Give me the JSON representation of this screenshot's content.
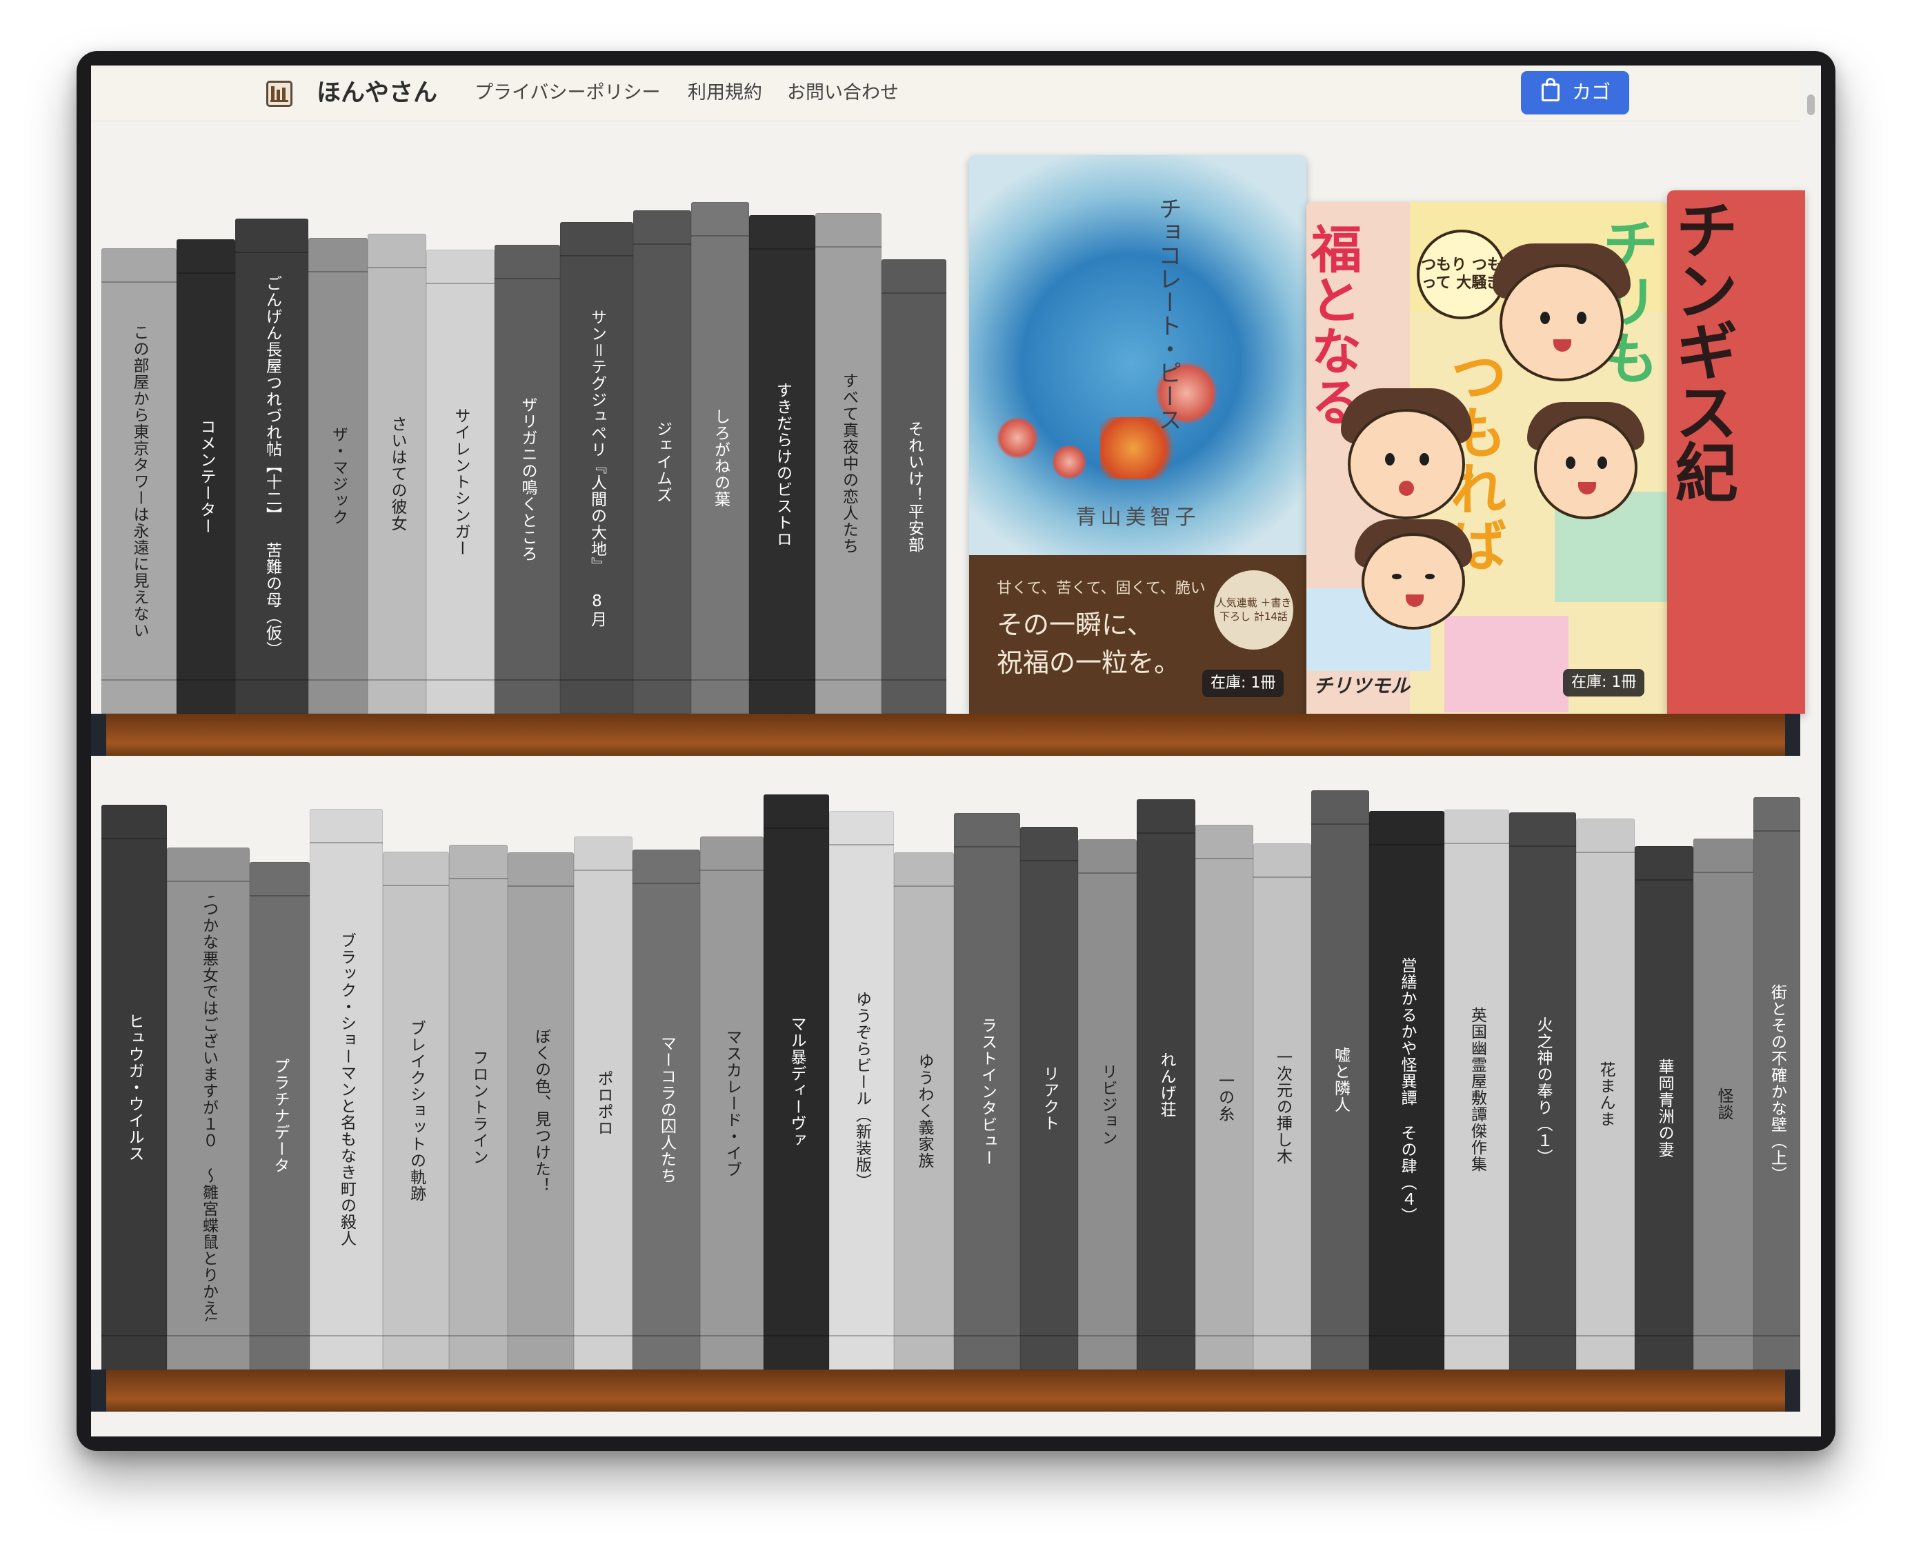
{
  "navbar": {
    "brand": "ほんやさん",
    "links": [
      "プライバシーポリシー",
      "利用規約",
      "お問い合わせ"
    ],
    "cart_label": "カゴ",
    "accent_color": "#3b6fe0"
  },
  "shelf1": {
    "spines": [
      {
        "title": "この部屋から東京タワーは永遠に見えない",
        "color": "#a7a7a7",
        "text_color": "#222222"
      },
      {
        "title": "コメンテーター",
        "color": "#2c2c2c",
        "text_color": "#ffffff"
      },
      {
        "title": "ごんげん長屋つれづれ帖【十二】 苦難の母（仮）",
        "color": "#3c3c3c",
        "text_color": "#ffffff"
      },
      {
        "title": "ザ・マジック",
        "color": "#909090",
        "text_color": "#1e1e1e"
      },
      {
        "title": "さいはての彼女",
        "color": "#bcbcbc",
        "text_color": "#222222"
      },
      {
        "title": "サイレントシンガー",
        "color": "#d2d2d2",
        "text_color": "#222222"
      },
      {
        "title": "ザリガニの鳴くところ",
        "color": "#5e5e5e",
        "text_color": "#ffffff"
      },
      {
        "title": "サン＝テグジュペリ『人間の大地』 8月",
        "color": "#4b4b4b",
        "text_color": "#ffffff"
      },
      {
        "title": "ジェイムズ",
        "color": "#565656",
        "text_color": "#ffffff"
      },
      {
        "title": "しろがねの葉",
        "color": "#777777",
        "text_color": "#ffffff"
      },
      {
        "title": "すきだらけのビストロ",
        "color": "#2e2e2e",
        "text_color": "#ffffff"
      },
      {
        "title": "すべて真夜中の恋人たち",
        "color": "#a0a0a0",
        "text_color": "#1e1e1e"
      },
      {
        "title": "それいけ！平安部",
        "color": "#5a5a5a",
        "text_color": "#ffffff"
      }
    ],
    "covers": [
      {
        "title": "チョコレート・ピース",
        "author": "青山美智子",
        "tagline": "甘くて、苦くて、固くて、脆い",
        "copy_lines": [
          "その一瞬に、",
          "祝福の一粒を。"
        ],
        "badge": "人気連載 ＋書き下ろし 計14話",
        "stock": "在庫: 1冊"
      },
      {
        "title": "チリもつもれば福となる",
        "bubble": "つもり つもって 大騒ぎ",
        "footer": "チリツモル",
        "stock": "在庫: 1冊"
      },
      {
        "title": "チンギス紀"
      }
    ]
  },
  "shelf2": {
    "spines": [
      {
        "title": "ヒュウガ・ウイルス",
        "color": "#3a3a3a",
        "text_color": "#ffffff"
      },
      {
        "title": "ふつつかな悪女ではございますが１０ 〜雛宮蝶鼠とりかえ伝〜",
        "color": "#939393",
        "text_color": "#1e1e1e"
      },
      {
        "title": "プラチナデータ",
        "color": "#6e6e6e",
        "text_color": "#ffffff"
      },
      {
        "title": "ブラック・ショーマンと名もなき町の殺人",
        "color": "#d6d6d6",
        "text_color": "#222222"
      },
      {
        "title": "ブレイクショットの軌跡",
        "color": "#c5c5c5",
        "text_color": "#222222"
      },
      {
        "title": "フロントライン",
        "color": "#b6b6b6",
        "text_color": "#222222"
      },
      {
        "title": "ぼくの色、見つけた！",
        "color": "#a4a4a4",
        "text_color": "#1e1e1e"
      },
      {
        "title": "ポロポロ",
        "color": "#d0d0d0",
        "text_color": "#222222"
      },
      {
        "title": "マーコラの囚人たち",
        "color": "#717171",
        "text_color": "#ffffff"
      },
      {
        "title": "マスカレード・イブ",
        "color": "#9a9a9a",
        "text_color": "#1e1e1e"
      },
      {
        "title": "マル暴ディーヴァ",
        "color": "#2a2a2a",
        "text_color": "#ffffff"
      },
      {
        "title": "ゆうぞらビール（新装版）",
        "color": "#dcdcdc",
        "text_color": "#222222"
      },
      {
        "title": "ゆうわく義家族",
        "color": "#bababa",
        "text_color": "#222222"
      },
      {
        "title": "ラストインタビュー",
        "color": "#666666",
        "text_color": "#ffffff"
      },
      {
        "title": "リアクト",
        "color": "#494949",
        "text_color": "#ffffff"
      },
      {
        "title": "リビジョン",
        "color": "#8e8e8e",
        "text_color": "#1e1e1e"
      },
      {
        "title": "れんげ荘",
        "color": "#404040",
        "text_color": "#ffffff"
      },
      {
        "title": "一の糸",
        "color": "#b0b0b0",
        "text_color": "#222222"
      },
      {
        "title": "一次元の挿し木",
        "color": "#c2c2c2",
        "text_color": "#222222"
      },
      {
        "title": "嘘と隣人",
        "color": "#5c5c5c",
        "text_color": "#ffffff"
      },
      {
        "title": "営繕かるかや怪異譚 その肆（４）",
        "color": "#282828",
        "text_color": "#ffffff"
      },
      {
        "title": "英国幽霊屋敷譚傑作集",
        "color": "#cfcfcf",
        "text_color": "#222222"
      },
      {
        "title": "火之神の奉り（１）",
        "color": "#474747",
        "text_color": "#ffffff"
      },
      {
        "title": "花まんま",
        "color": "#c9c9c9",
        "text_color": "#222222"
      },
      {
        "title": "華岡青洲の妻",
        "color": "#3d3d3d",
        "text_color": "#ffffff"
      },
      {
        "title": "怪談",
        "color": "#8a8a8a",
        "text_color": "#1e1e1e"
      },
      {
        "title": "街とその不確かな壁（上）",
        "color": "#6b6b6b",
        "text_color": "#ffffff"
      }
    ]
  }
}
